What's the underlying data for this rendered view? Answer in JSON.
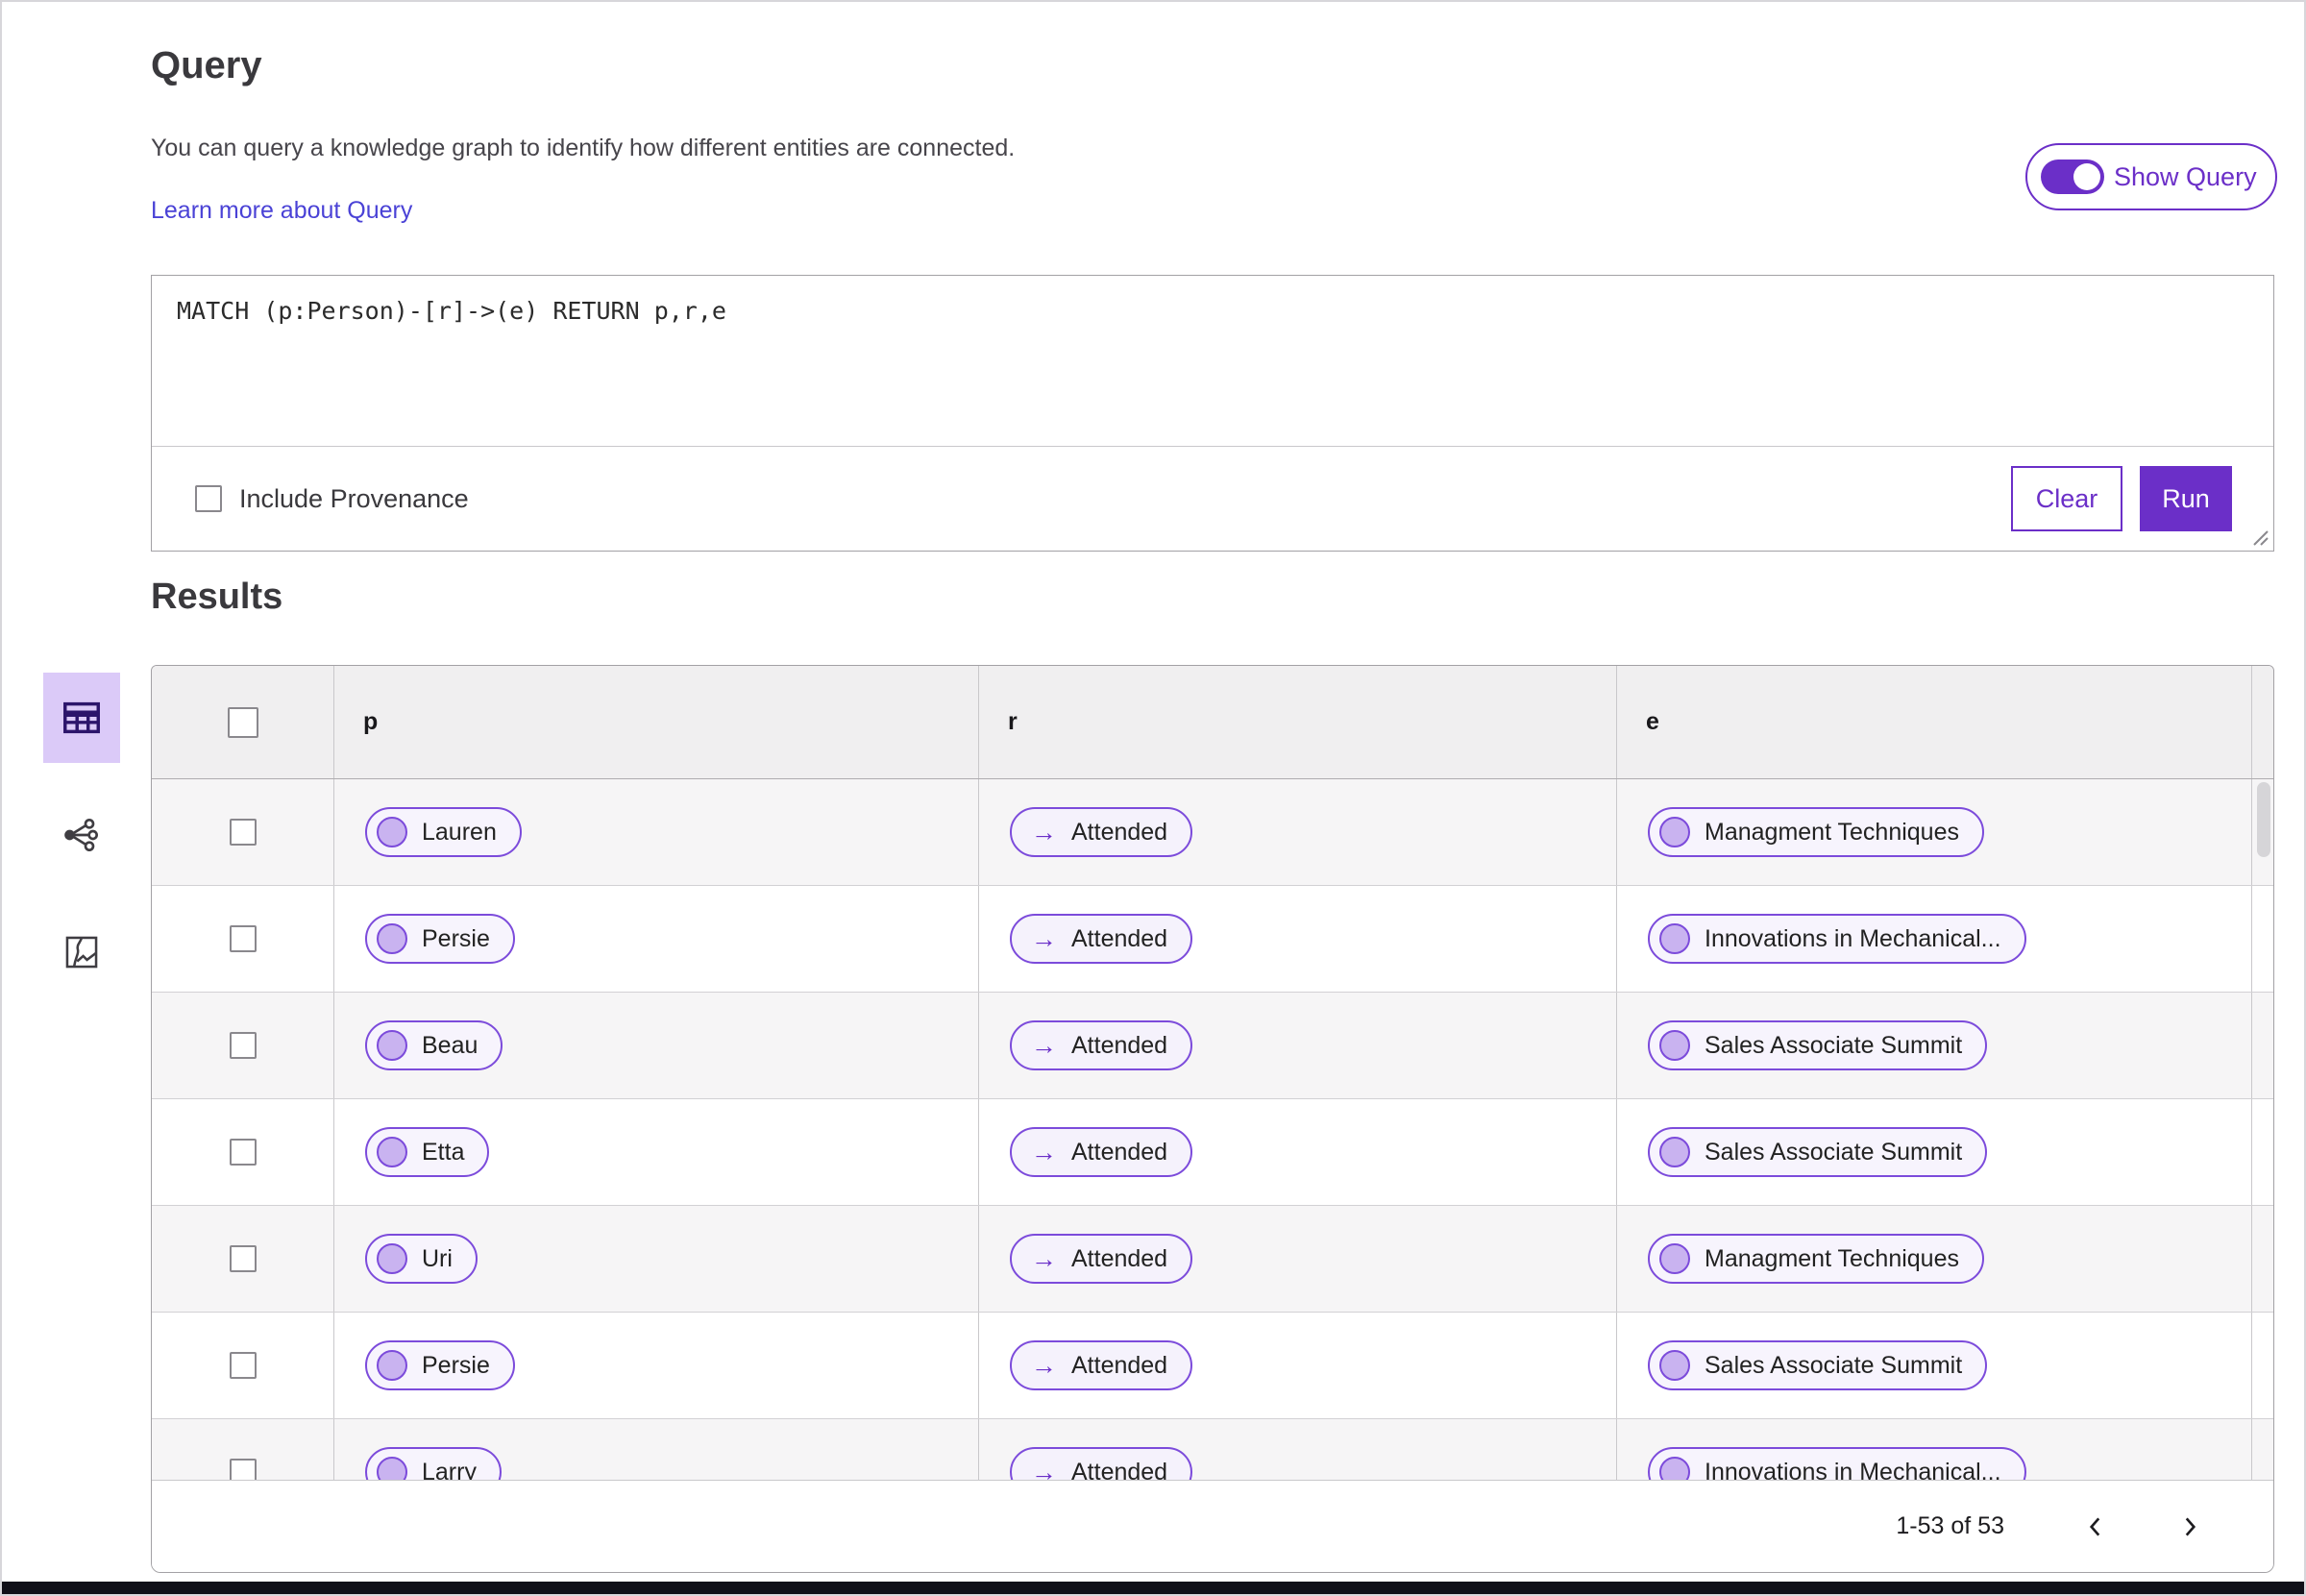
{
  "header": {
    "title": "Query",
    "description": "You can query a knowledge graph to identify how different entities are connected.",
    "learn_more": "Learn more about Query",
    "show_query_label": "Show Query",
    "show_query_on": true
  },
  "query_editor": {
    "query_text": "MATCH (p:Person)-[r]->(e) RETURN p,r,e",
    "include_provenance_label": "Include Provenance",
    "include_provenance_checked": false,
    "clear_label": "Clear",
    "run_label": "Run"
  },
  "results": {
    "title": "Results",
    "view_switcher": [
      {
        "name": "table-view",
        "icon": "table-icon",
        "selected": true
      },
      {
        "name": "graph-view",
        "icon": "graph-icon",
        "selected": false
      },
      {
        "name": "map-view",
        "icon": "map-icon",
        "selected": false
      }
    ],
    "table": {
      "columns": [
        "p",
        "r",
        "e"
      ],
      "column_kinds": {
        "p": "node",
        "r": "relationship",
        "e": "node"
      },
      "relationship_arrow": "→",
      "rows": [
        {
          "p": "Lauren",
          "r": "Attended",
          "e": "Managment Techniques"
        },
        {
          "p": "Persie",
          "r": "Attended",
          "e": "Innovations in Mechanical..."
        },
        {
          "p": "Beau",
          "r": "Attended",
          "e": "Sales Associate Summit"
        },
        {
          "p": "Etta",
          "r": "Attended",
          "e": "Sales Associate Summit"
        },
        {
          "p": "Uri",
          "r": "Attended",
          "e": "Managment Techniques"
        },
        {
          "p": "Persie",
          "r": "Attended",
          "e": "Sales Associate Summit"
        },
        {
          "p": "Larry",
          "r": "Attended",
          "e": "Innovations in Mechanical..."
        }
      ]
    },
    "pagination": {
      "range_label": "1-53 of 53",
      "prev_icon": "chevron-left-icon",
      "next_icon": "chevron-right-icon"
    }
  },
  "colors": {
    "accent": "#6b2fc8",
    "pill_border": "#7c4bdb",
    "pill_bg": "#f7f4fd",
    "node_circle": "#c9b3f0",
    "link": "#4a42d6",
    "header_bg": "#f0eff0",
    "zebra_row": "#f6f5f6",
    "selected_view_bg": "#dbcaf8",
    "bottom_strip": "#101018"
  }
}
